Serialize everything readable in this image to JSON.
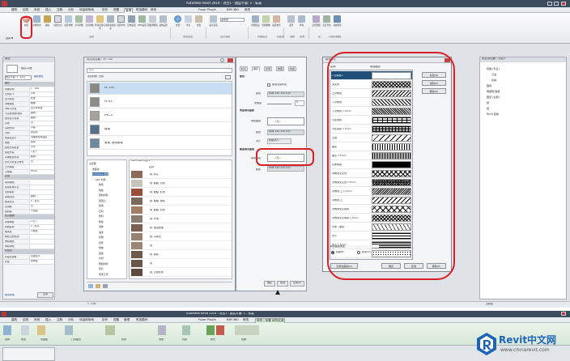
{
  "app": {
    "title": "Autodesk Revit 2014 -    项目1 - 楼层平面: 1 - 标高",
    "menus": [
      "建筑",
      "结构",
      "系统",
      "插入",
      "注释",
      "分析",
      "体量和场地",
      "协作",
      "视图",
      "管理",
      "附加模块",
      "修改",
      "Fuzor Plugin",
      "BIM 360",
      "修改"
    ],
    "active_menu_index": 9
  },
  "ribbon": {
    "buttons": [
      "材质",
      "对象样式",
      "捕捉",
      "项目信息",
      "项目参数",
      "共享参数",
      "全局参数",
      "传递项目标准",
      "清除未使用项",
      "项目单位",
      "结构设置",
      "MEP设置",
      "面板明细表",
      "其他设置",
      "位置",
      "坐标",
      "位置",
      "设计选项",
      "主模型",
      "管理链接",
      "管理图像",
      "贴花类型",
      "选择",
      "查询",
      "宏管理器",
      "宏安全性",
      "动态模型"
    ],
    "groups": [
      "设置",
      "项目位置",
      "设计选项",
      "管理项目",
      "阶段化",
      "选择",
      "查询",
      "宏",
      "可视化编程"
    ],
    "left_label": "选择 ▼"
  },
  "properties": {
    "title": "属性",
    "type_name": "楼层平面",
    "selector": "楼层平面: 1 - 标高",
    "edit_type": "编辑类型",
    "section_graphics": "图形",
    "rows": [
      {
        "k": "视图比例",
        "v": "1 : 100"
      },
      {
        "k": "比例值 1:",
        "v": "100"
      },
      {
        "k": "显示模型",
        "v": "标准"
      },
      {
        "k": "详细程度",
        "v": "粗略"
      },
      {
        "k": "零件可见性",
        "v": "显示原状态"
      },
      {
        "k": "可见性/图形替换",
        "v": "编辑..."
      },
      {
        "k": "图形显示选项",
        "v": "编辑..."
      },
      {
        "k": "基线",
        "v": "无"
      },
      {
        "k": "基线方向",
        "v": "平面"
      },
      {
        "k": "方向",
        "v": "项目北"
      },
      {
        "k": "墙连接显示",
        "v": "清理所有墙连接"
      },
      {
        "k": "规程",
        "v": "建筑"
      },
      {
        "k": "颜色方案位置",
        "v": "背景"
      },
      {
        "k": "颜色方案",
        "v": "<无>"
      },
      {
        "k": "系统颜色方案",
        "v": "编辑..."
      },
      {
        "k": "默认分析显示样式",
        "v": "无"
      },
      {
        "k": "日光路径",
        "v": ""
      },
      {
        "k": "子规程",
        "v": "HVAC"
      }
    ],
    "section_extents": "范围",
    "rows2": [
      {
        "k": "裁剪视图",
        "v": ""
      },
      {
        "k": "裁剪区域可见",
        "v": ""
      },
      {
        "k": "注释裁剪",
        "v": ""
      },
      {
        "k": "视图范围",
        "v": "编辑..."
      },
      {
        "k": "相关标高",
        "v": "1 - 标高"
      },
      {
        "k": "范围框",
        "v": "无"
      },
      {
        "k": "截剪裁",
        "v": "不剪裁"
      }
    ],
    "section_identity": "标识数据",
    "rows3": [
      {
        "k": "视图样板",
        "v": "<无>"
      },
      {
        "k": "视图名称",
        "v": "1 - 标高"
      },
      {
        "k": "相关性",
        "v": "不相关"
      },
      {
        "k": "图纸上的标题",
        "v": ""
      },
      {
        "k": "参照图纸",
        "v": ""
      },
      {
        "k": "参照详图",
        "v": ""
      }
    ],
    "section_phase": "阶段化",
    "rows4": [
      {
        "k": "阶段过滤器",
        "v": "全部显示"
      },
      {
        "k": "阶段",
        "v": "新构造"
      }
    ],
    "help": "属性帮助",
    "apply": "应用"
  },
  "material_browser": {
    "title": "材质浏览器 - PE 100",
    "search_placeholder": "搜索",
    "filter_label": "项目材质: 全部",
    "materials": [
      {
        "name": "PE 100",
        "color": "#8a8680"
      },
      {
        "name": "PE 63",
        "color": "#8f8b86"
      },
      {
        "name": "PVC-U",
        "color": "#a6a39f"
      },
      {
        "name": "玻璃",
        "color": "#55708a"
      },
      {
        "name": "玻璃, 透明玻璃",
        "color": "#6e8aa1"
      }
    ],
    "lib_header": "Autodesk 材质 ▾",
    "lib_col": "名称",
    "tree": [
      "主视图",
      "收藏夹",
      "Autodesk 材质",
      "AEC 材质",
      "玻璃",
      "地板",
      "隔热材料",
      "混凝土",
      "其他",
      "石料",
      "塑料",
      "陶瓷",
      "液体",
      "油漆",
      "织物",
      "纸张",
      "地被",
      "金属",
      "木材",
      "屋面材料",
      "砖石",
      "现场工作"
    ],
    "lib_items": [
      {
        "name": "瓷, 碎花",
        "color": "#8b6b58"
      },
      {
        "name": "瓷, 粗糙, 白色",
        "color": "#c9c4bb"
      },
      {
        "name": "瓷, 粗糙, 红色",
        "color": "#9a4f3a"
      },
      {
        "name": "瓷, 粗糙, 褐色",
        "color": "#7a6a5c"
      },
      {
        "name": "瓷, 粗糙, 杂色",
        "color": "#a07e66"
      },
      {
        "name": "瓷, 光滑",
        "color": "#8b7c70"
      },
      {
        "name": "瓷, 镶边纹理",
        "color": "#7d5f50"
      },
      {
        "name": "瓷, 马赛克",
        "color": "#96826e"
      },
      {
        "name": "瓷",
        "color": "#9d8676"
      },
      {
        "name": "瓷, 褐色",
        "color": "#6f5a4b"
      },
      {
        "name": "瓷",
        "color": "#6a574c"
      },
      {
        "name": "瓷, 立砌砖斑",
        "color": "#5f4a3e"
      }
    ],
    "zoom": "1"
  },
  "editor": {
    "tabs": [
      "标识",
      "图形",
      "外观",
      "物理",
      "热度"
    ],
    "active_tab": 1,
    "section_shading": "着色",
    "use_render": "使用渲染外观",
    "color_label": "颜色",
    "color_value": "RGB 120 120 120",
    "transp_label": "透明度",
    "transp_value": "0",
    "section_surface": "表面填充图案",
    "pattern_label": "填充图案",
    "pattern_value": "<无>",
    "align_label": "对齐",
    "align_value": "纹理对齐...",
    "section_cut": "截面填充图案",
    "cut_pattern_value": "<无>",
    "ok": "确定",
    "cancel": "取消",
    "apply": "应用(A)"
  },
  "fill_patterns": {
    "title": "填充样式",
    "col_name": "名称:",
    "col_pattern": "填充图案:",
    "items": [
      "<无填充>",
      "交叉线",
      "上对角线",
      "下对角线",
      "下对角线 1.5mm",
      "分区填充",
      "分区填充 1.5mm",
      "土壤",
      "垂直",
      "垂直 1.5mm",
      "实体填充",
      "对角线交叉线",
      "对角线交叉线 1.5mm",
      "对角线-上 1.5mm",
      "对角线-上",
      "对角线交叉填充",
      "对角线交叉填充 1.5mm",
      "木质 - 覆层",
      "水平",
      "水平 1.5mm",
      "沙"
    ],
    "buttons": [
      "新建(N)",
      "编辑(E)",
      "删除(D)"
    ],
    "type_label": "填充图案类型",
    "drafting": "绘图(R)",
    "model": "模型(M)",
    "no_fill": "无填充图案(N)",
    "ok": "确定",
    "cancel": "取消",
    "help": "帮助(H)"
  },
  "project_browser": {
    "title": "项目浏览器 - 项目1",
    "items": [
      "视图 (专业)",
      "卫浴",
      "机械",
      "图例",
      "明细表/数量",
      "图纸 (全部)",
      "族",
      "组",
      "Revit 链接"
    ]
  },
  "status": {
    "text": "1 : 100",
    "main_model": "主模型"
  },
  "app2": {
    "title": "Autodesk Revit 2014 -    项目1 - 楼层平面: 1 - 标高",
    "menus": [
      "建筑",
      "结构",
      "系统",
      "插入",
      "注释",
      "分析",
      "体量和场地",
      "协作",
      "视图",
      "管理",
      "附加模块",
      "Fuzor Plugin",
      "BIM 360",
      "修改",
      "修改 | 放置 填充区域"
    ],
    "groups": [
      "选择",
      "属性",
      "剪贴板",
      "几何图形",
      "修改",
      "测量",
      "创建",
      "模式",
      "绘制"
    ]
  },
  "watermark": {
    "brand": "Revit中文网",
    "url": "www.chinarevit.com"
  },
  "colors": {
    "highlight": "#d81f26",
    "title_bar": "#3c4c5e",
    "selection": "#1f4e79"
  }
}
